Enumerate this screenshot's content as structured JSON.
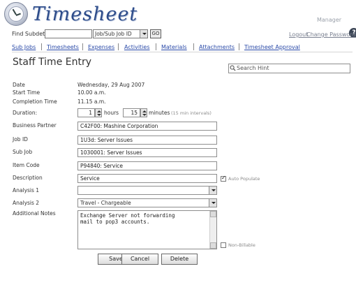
{
  "header": {
    "app_title": "Timesheet",
    "user_label": "Manager",
    "help_icon": "?"
  },
  "find_bar": {
    "label": "Find Subdet:",
    "input_value": "",
    "select_value": "Job/Sub Job ID",
    "go_label": "GO",
    "logout_label": "Logout",
    "change_password_label": "Change Password"
  },
  "nav": {
    "items": [
      {
        "label": "Sub Jobs"
      },
      {
        "label": "Timesheets"
      },
      {
        "label": "Expenses"
      },
      {
        "label": "Activities"
      },
      {
        "label": "Materials"
      },
      {
        "label": "Attachments"
      },
      {
        "label": "Timesheet Approval"
      }
    ]
  },
  "page": {
    "title": "Staff Time Entry",
    "search_placeholder": "Search Hint"
  },
  "form": {
    "date_label": "Date",
    "date_value": "Wednesday, 29 Aug 2007",
    "start_label": "Start Time",
    "start_value": "10.00 a.m.",
    "completion_label": "Completion Time",
    "completion_value": "11.15 a.m.",
    "duration_label": "Duration:",
    "duration_hours": "1",
    "hours_label": "hours",
    "duration_minutes": "15",
    "minutes_label": "minutes",
    "minutes_hint": "(15 min intervals)",
    "business_partner_label": "Business Partner",
    "business_partner_value": "C42F00: Mashine Corporation",
    "job_id_label": "Job ID",
    "job_id_value": "1U3d: Server Issues",
    "sub_job_label": "Sub Job",
    "sub_job_value": "1030001: Server Issues",
    "item_code_label": "Item Code",
    "item_code_value": "P94840: Service",
    "description_label": "Description",
    "description_value": "Service",
    "auto_populate_label": "Auto Populate",
    "auto_populate_checked": true,
    "analysis1_label": "Analysis 1",
    "analysis1_value": "",
    "analysis2_label": "Analysis 2",
    "analysis2_value": "Travel - Chargeable",
    "notes_label": "Additional Notes",
    "notes_value": "Exchange Server not forwarding\nmail to pop3 accounts.",
    "non_billable_label": "Non-Billable",
    "non_billable_checked": false
  },
  "buttons": {
    "save": "Save",
    "cancel": "Cancel",
    "delete": "Delete"
  }
}
